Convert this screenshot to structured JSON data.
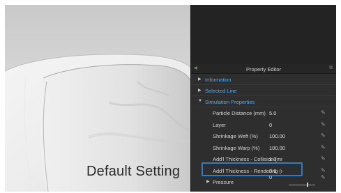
{
  "viewport": {
    "caption": "Default Setting"
  },
  "panel": {
    "title": "Property Editor",
    "sections": [
      {
        "label": "Information"
      },
      {
        "label": "Selected Line"
      },
      {
        "label": "Simulation Properties"
      }
    ],
    "properties": [
      {
        "name": "Particle Distance (mm)",
        "value": "5.0"
      },
      {
        "name": "Layer",
        "value": "0"
      },
      {
        "name": "Shrinkage Weft (%)",
        "value": "100.00"
      },
      {
        "name": "Shrinkage Warp (%)",
        "value": "100.00"
      },
      {
        "name": "Add'l Thickness - Collision (mr",
        "value": "1.0"
      },
      {
        "name": "Add'l Thickness - Rendering (n",
        "value": "0.0"
      }
    ],
    "pressure": {
      "label": "Pressure",
      "value": "0"
    }
  },
  "colors": {
    "accent_blue": "#2f7cc4",
    "section_text": "#5ea6e6",
    "panel_bg": "#2e2e2e"
  }
}
